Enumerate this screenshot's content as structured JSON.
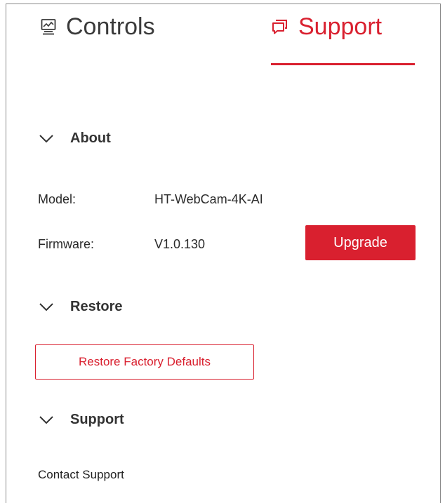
{
  "tabs": {
    "controls": {
      "label": "Controls",
      "icon": "monitor-chart-icon"
    },
    "support": {
      "label": "Support",
      "icon": "chat-bubbles-icon",
      "active": true
    }
  },
  "colors": {
    "accent": "#d9202f",
    "text": "#222222",
    "muted": "#3a3a3a"
  },
  "about": {
    "title": "About",
    "model_label": "Model:",
    "model_value": "HT-WebCam-4K-AI",
    "firmware_label": "Firmware:",
    "firmware_value": "V1.0.130",
    "upgrade_label": "Upgrade"
  },
  "restore": {
    "title": "Restore",
    "button_label": "Restore Factory Defaults"
  },
  "support": {
    "title": "Support",
    "contact_label": "Contact Support"
  }
}
